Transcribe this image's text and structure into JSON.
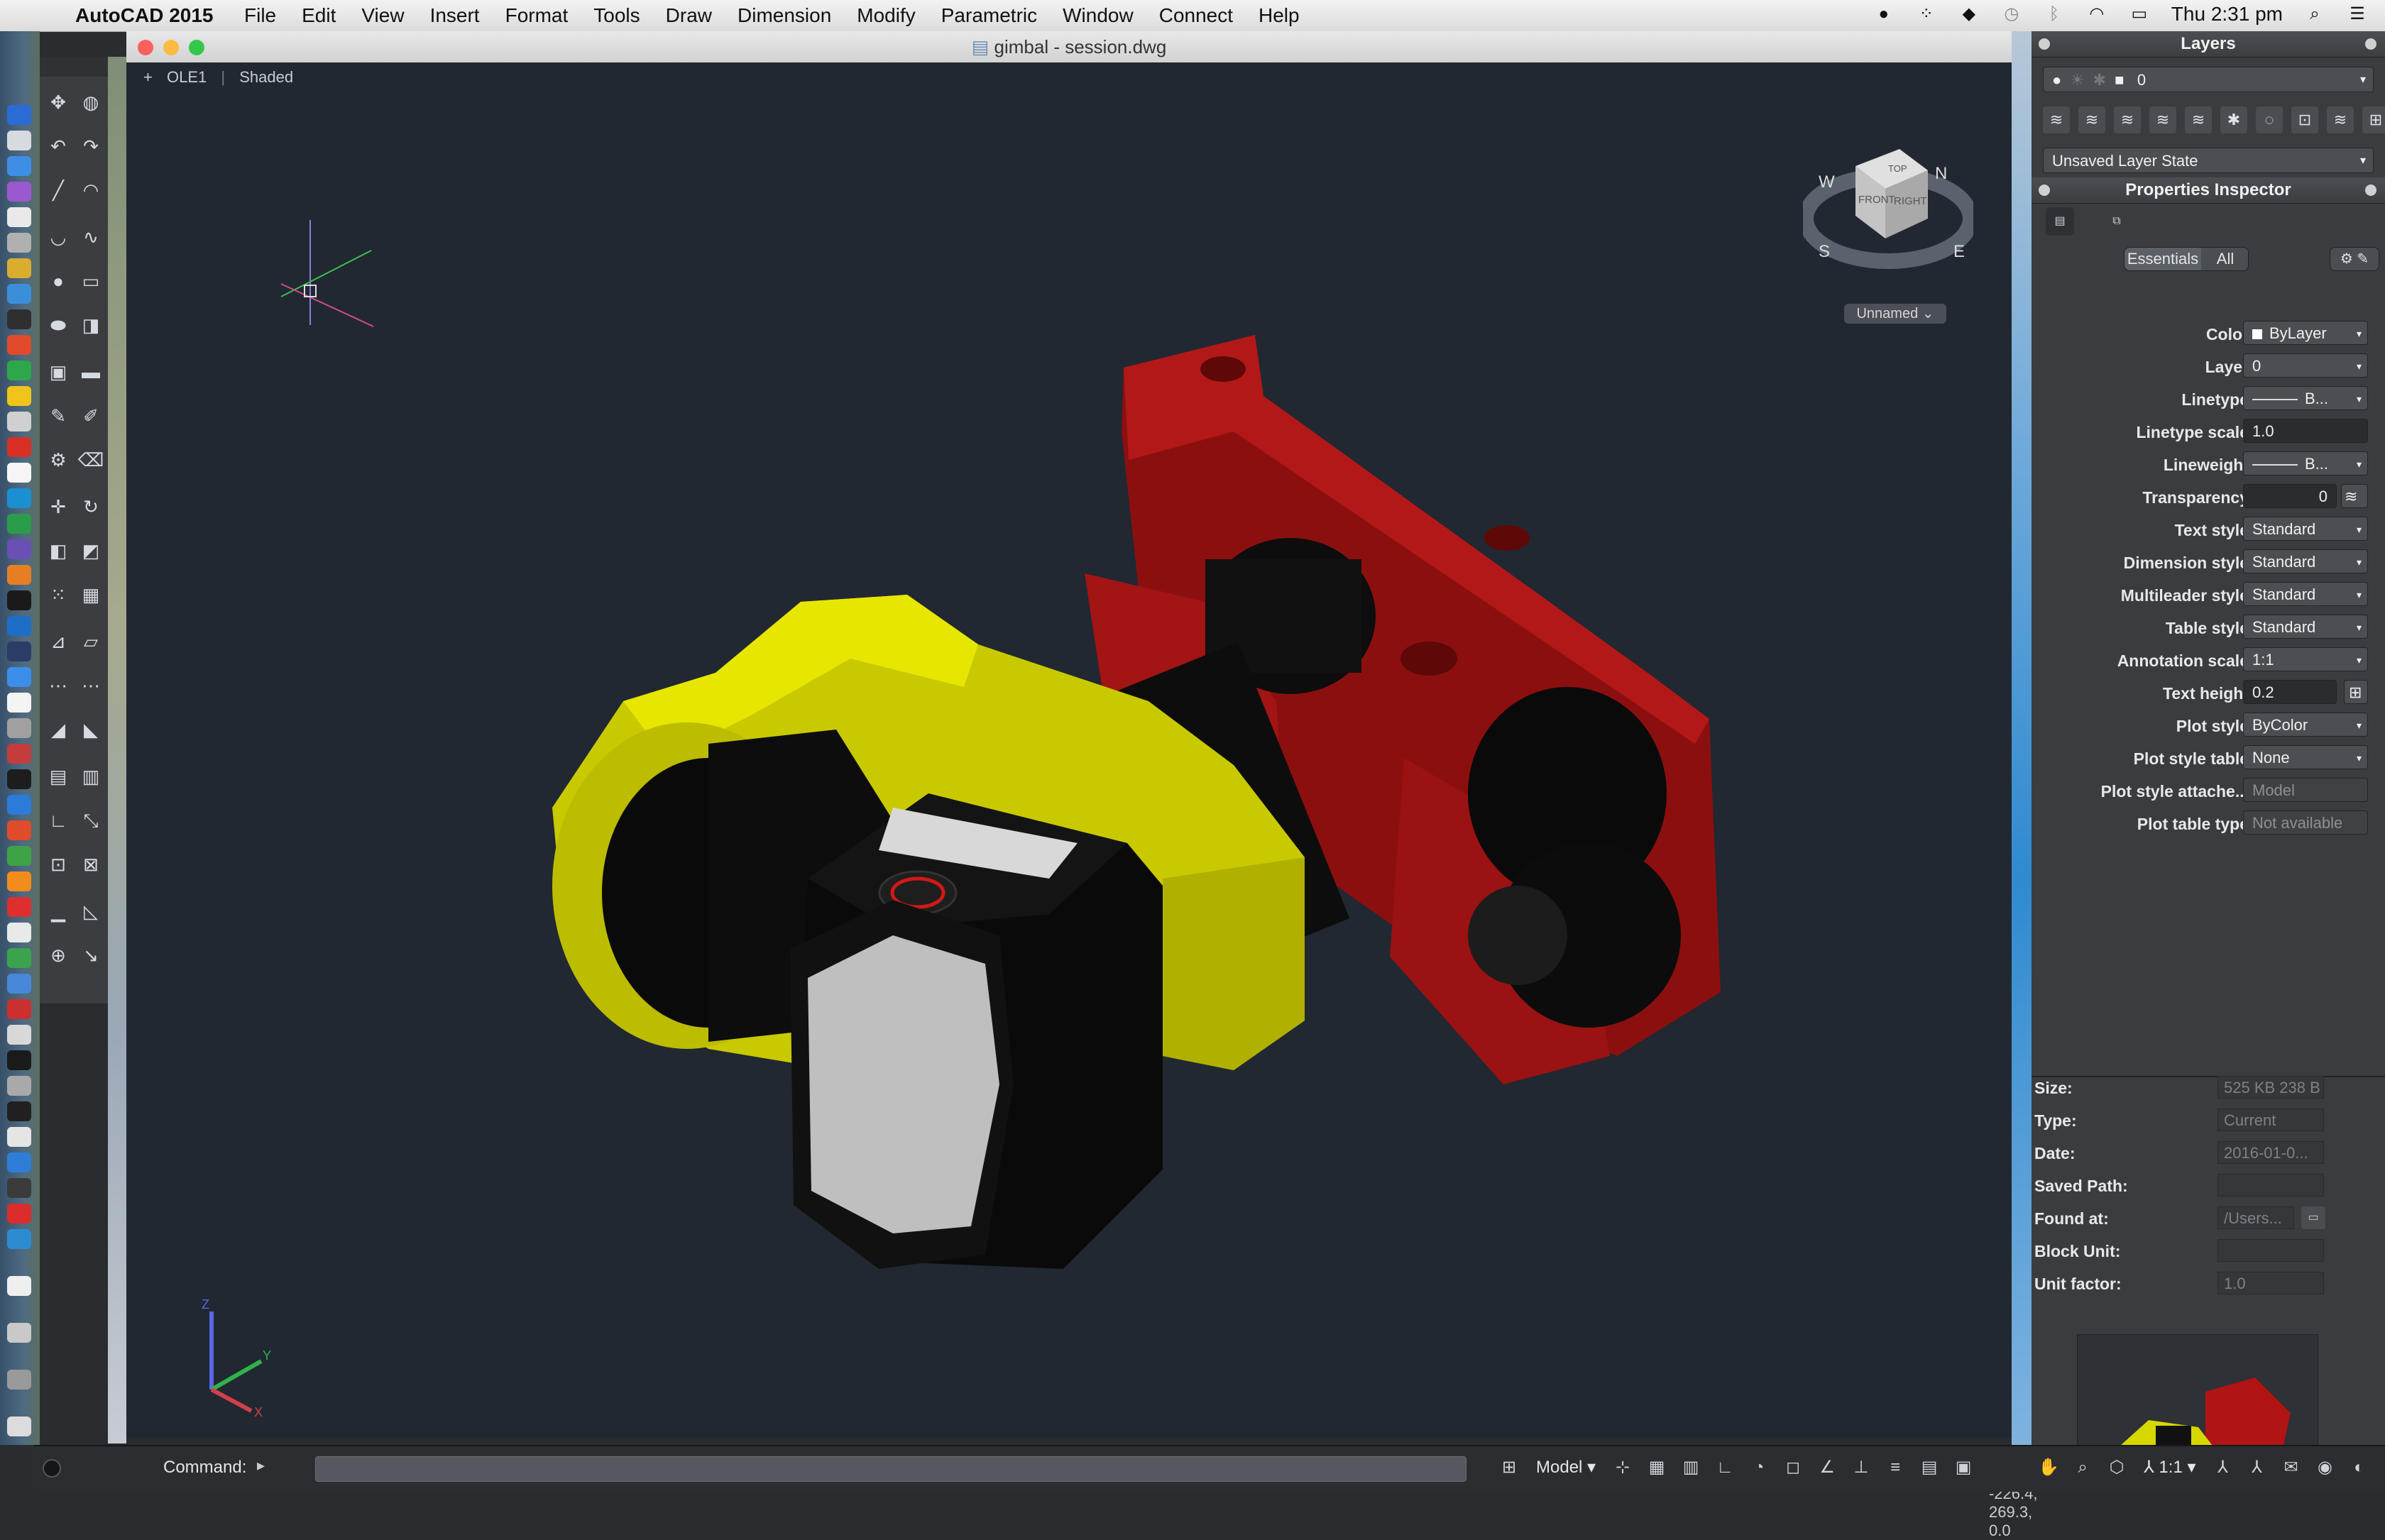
{
  "menubar": {
    "app_name": "AutoCAD 2015",
    "menus": [
      "File",
      "Edit",
      "View",
      "Insert",
      "Format",
      "Tools",
      "Draw",
      "Dimension",
      "Modify",
      "Parametric",
      "Window",
      "Connect",
      "Help"
    ],
    "clock": "Thu 2:31 pm",
    "status_icons": [
      "evernote-icon",
      "grid-icon",
      "dropbox-icon",
      "time-machine-icon",
      "bluetooth-icon",
      "wifi-icon",
      "battery-icon"
    ]
  },
  "window": {
    "title": "gimbal - session.dwg",
    "viewport_labels": [
      "+",
      "OLE1",
      "Shaded"
    ],
    "viewcube": {
      "top": "TOP",
      "front": "FRONT",
      "right": "RIGHT",
      "compass": [
        "N",
        "W",
        "S",
        "E"
      ],
      "ucs_menu": "Unnamed"
    },
    "coordinates": "-226.4, 269.3, 0.0"
  },
  "model_colors": {
    "yellow": "#e6e600",
    "red": "#b01414",
    "black": "#0c0c0c",
    "grey": "#bdbdbd"
  },
  "command": {
    "label": "Command:",
    "value": ""
  },
  "statusbar": {
    "model_label": "Model",
    "scale_label": "1:1"
  },
  "layers": {
    "title": "Layers",
    "current_layer": "0",
    "layer_state": "Unsaved Layer State"
  },
  "properties": {
    "title": "Properties Inspector",
    "tab_essentials": "Essentials",
    "tab_all": "All",
    "rows": [
      {
        "label": "Color",
        "value": "ByLayer",
        "kind": "swatch"
      },
      {
        "label": "Layer",
        "value": "0",
        "kind": "combo"
      },
      {
        "label": "Linetype",
        "value": "B...",
        "kind": "line"
      },
      {
        "label": "Linetype scale",
        "value": "1.0",
        "kind": "input"
      },
      {
        "label": "Lineweight",
        "value": "B...",
        "kind": "line"
      },
      {
        "label": "Transparency",
        "value": "0",
        "kind": "input"
      },
      {
        "label": "Text style",
        "value": "Standard",
        "kind": "combo"
      },
      {
        "label": "Dimension style",
        "value": "Standard",
        "kind": "combo"
      },
      {
        "label": "Multileader style",
        "value": "Standard",
        "kind": "combo"
      },
      {
        "label": "Table style",
        "value": "Standard",
        "kind": "combo"
      },
      {
        "label": "Annotation scale",
        "value": "1:1",
        "kind": "combo"
      },
      {
        "label": "Text height",
        "value": "0.2",
        "kind": "input"
      },
      {
        "label": "Plot style",
        "value": "ByColor",
        "kind": "combo"
      },
      {
        "label": "Plot style table",
        "value": "None",
        "kind": "combo"
      },
      {
        "label": "Plot style attache...",
        "value": "Model",
        "kind": "disabled"
      },
      {
        "label": "Plot table type",
        "value": "Not available",
        "kind": "disabled"
      }
    ]
  },
  "block_info": {
    "rows": [
      {
        "label": "Size:",
        "value": "525 KB 238 B"
      },
      {
        "label": "Type:",
        "value": "Current"
      },
      {
        "label": "Date:",
        "value": "2016-01-0..."
      },
      {
        "label": "Saved Path:",
        "value": ""
      },
      {
        "label": "Found at:",
        "value": "/Users..."
      },
      {
        "label": "Block Unit:",
        "value": ""
      },
      {
        "label": "Unit factor:",
        "value": "1.0"
      }
    ]
  }
}
